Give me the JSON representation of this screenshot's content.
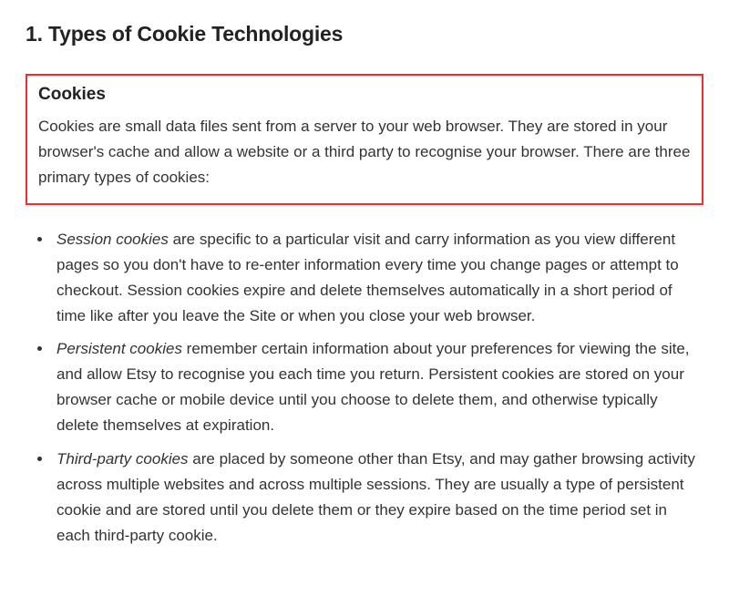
{
  "heading": "1. Types of Cookie Technologies",
  "box": {
    "title": "Cookies",
    "body": "Cookies are small data files sent from a server to your web browser. They are stored in your browser's cache and allow a website or a third party to recognise your browser. There are three primary types of cookies:"
  },
  "items": [
    {
      "term": "Session cookies",
      "desc": " are specific to a particular visit and carry information as you view different pages so you don't have to re-enter information every time you change pages or attempt to checkout. Session cookies expire and delete themselves automatically in a short period of time like after you leave the Site or when you close your web browser."
    },
    {
      "term": "Persistent cookies",
      "desc": " remember certain information about your preferences for viewing the site, and allow Etsy to recognise you each time you return. Persistent cookies are stored on your browser cache or mobile device until you choose to delete them, and otherwise typically delete themselves at expiration."
    },
    {
      "term": "Third-party cookies",
      "desc": " are placed by someone other than Etsy, and may gather browsing activity across multiple websites and across multiple sessions. They are usually a type of persistent cookie and are stored until you delete them or they expire based on the time period set in each third-party cookie."
    }
  ]
}
